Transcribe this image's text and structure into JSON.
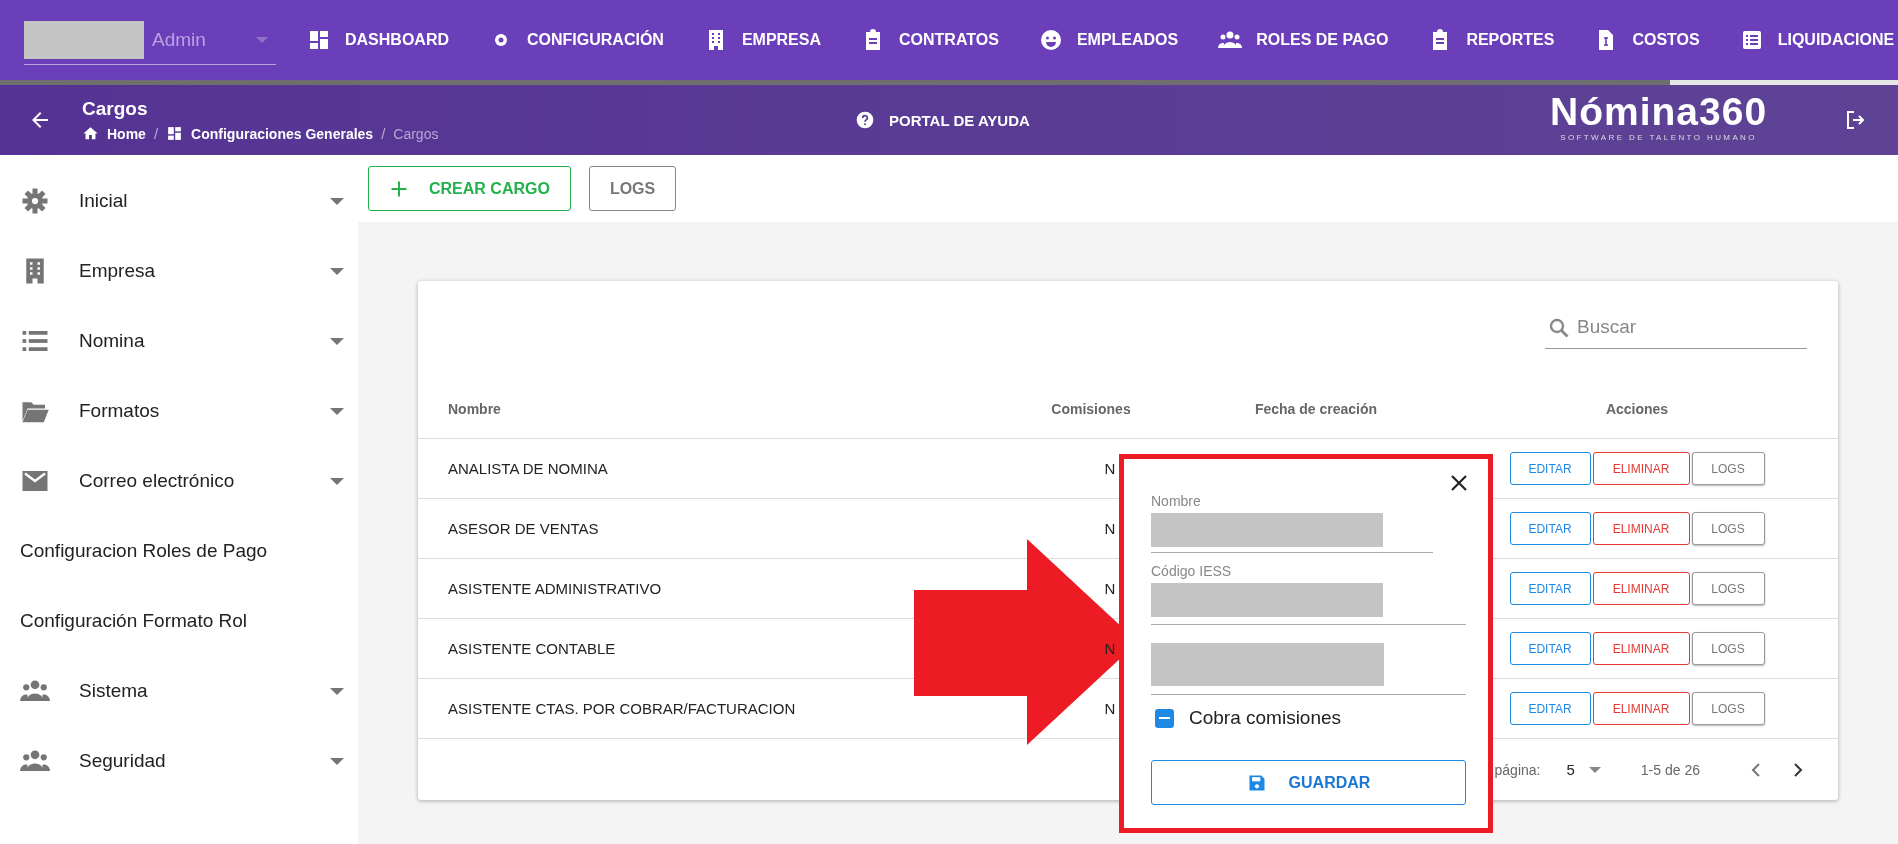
{
  "top_nav": {
    "user": {
      "name": "Admin",
      "redacted": true
    },
    "items": [
      {
        "label": "DASHBOARD",
        "selected": false
      },
      {
        "label": "CONFIGURACIÓN",
        "selected": false
      },
      {
        "label": "EMPRESA",
        "selected": false
      },
      {
        "label": "CONTRATOS",
        "selected": false
      },
      {
        "label": "EMPLEADOS",
        "selected": false
      },
      {
        "label": "ROLES DE PAGO",
        "selected": false
      },
      {
        "label": "REPORTES",
        "selected": false
      },
      {
        "label": "COSTOS",
        "selected": false
      },
      {
        "label": "LIQUIDACIONE",
        "selected": true
      }
    ]
  },
  "header": {
    "title": "Cargos",
    "breadcrumb": [
      {
        "label": "Home",
        "current": false
      },
      {
        "separator": "/",
        "label": "Configuraciones Generales",
        "current": false
      },
      {
        "separator": "/",
        "label": "Cargos",
        "current": true
      }
    ],
    "help": "PORTAL DE AYUDA",
    "logo": "Nómina360",
    "logo_tagline": "SOFTWARE DE TALENTO HUMANO"
  },
  "sidebar": {
    "items": [
      {
        "label": "Inicial",
        "kind": "group"
      },
      {
        "label": "Empresa",
        "kind": "group"
      },
      {
        "label": "Nomina",
        "kind": "group"
      },
      {
        "label": "Formatos",
        "kind": "group"
      },
      {
        "label": "Correo electrónico",
        "kind": "group"
      },
      {
        "label": "Configuracion Roles de Pago",
        "kind": "link"
      },
      {
        "label": "Configuración Formato Rol",
        "kind": "link"
      },
      {
        "label": "Sistema",
        "kind": "group"
      },
      {
        "label": "Seguridad",
        "kind": "group"
      }
    ]
  },
  "toolbar": {
    "create_button": "CREAR CARGO",
    "logs_button": "LOGS"
  },
  "table": {
    "search": {
      "placeholder": "Buscar"
    },
    "columns": [
      "Nombre",
      "Comisiones",
      "Fecha de creación",
      "Acciones"
    ],
    "rows": [
      {
        "name": "ANALISTA DE NOMINA",
        "comisiones": "N",
        "actions": [
          "EDITAR",
          "ELIMINAR",
          "LOGS"
        ]
      },
      {
        "name": "ASESOR DE VENTAS",
        "comisiones": "N",
        "actions": [
          "EDITAR",
          "ELIMINAR",
          "LOGS"
        ]
      },
      {
        "name": "ASISTENTE ADMINISTRATIVO",
        "comisiones": "N",
        "actions": [
          "EDITAR",
          "ELIMINAR",
          "LOGS"
        ]
      },
      {
        "name": "ASISTENTE CONTABLE",
        "comisiones": "N",
        "actions": [
          "EDITAR",
          "ELIMINAR",
          "LOGS"
        ]
      },
      {
        "name": "ASISTENTE CTAS. POR COBRAR/FACTURACION",
        "comisiones": "N",
        "actions": [
          "EDITAR",
          "ELIMINAR",
          "LOGS"
        ]
      }
    ],
    "pagination": {
      "rows_label": "página:",
      "rows_per_page": "5",
      "range": "1-5 de 26"
    }
  },
  "dialog": {
    "fields": [
      {
        "label": "Nombre",
        "redacted": true
      },
      {
        "label": "Código IESS",
        "redacted": true
      },
      {
        "redacted": true
      }
    ],
    "checkbox": {
      "label": "Cobra comisiones",
      "indeterminate": true
    },
    "save_button": "GUARDAR"
  },
  "annotation": {
    "arrow": true,
    "highlight": true
  }
}
